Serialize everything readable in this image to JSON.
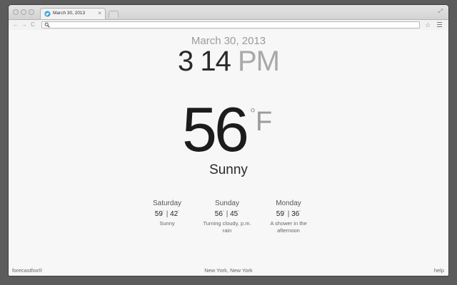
{
  "browser": {
    "tab_title": "March 30, 2013",
    "tab_close": "×",
    "fullscreen_icon": "⤢",
    "address": {
      "value": "",
      "placeholder": ""
    },
    "back_icon": "←",
    "forward_icon": "→",
    "reload_icon": "C",
    "star_icon": "☆"
  },
  "weather": {
    "date": "March 30, 2013",
    "time": "3 14",
    "ampm": "PM",
    "temperature": "56",
    "degree_symbol": "°",
    "unit": "F",
    "condition": "Sunny",
    "forecast": [
      {
        "day": "Saturday",
        "high": "59",
        "low": "42",
        "deg": "°",
        "separator": "|",
        "desc": "Sunny"
      },
      {
        "day": "Sunday",
        "high": "56",
        "low": "45",
        "deg": "°",
        "separator": "|",
        "desc": "Turning cloudy, p.m. rain"
      },
      {
        "day": "Monday",
        "high": "59",
        "low": "36",
        "deg": "°",
        "separator": "|",
        "desc": "A shower in the afternoon"
      }
    ]
  },
  "footer": {
    "brand": "forecastfox®",
    "location": "New York, New York",
    "help": "help"
  },
  "colors": {
    "background": "#f7f7f7",
    "text_dark": "#1c1c1c",
    "text_muted": "#9b9b9b",
    "favicon": "#3aa0d8"
  }
}
